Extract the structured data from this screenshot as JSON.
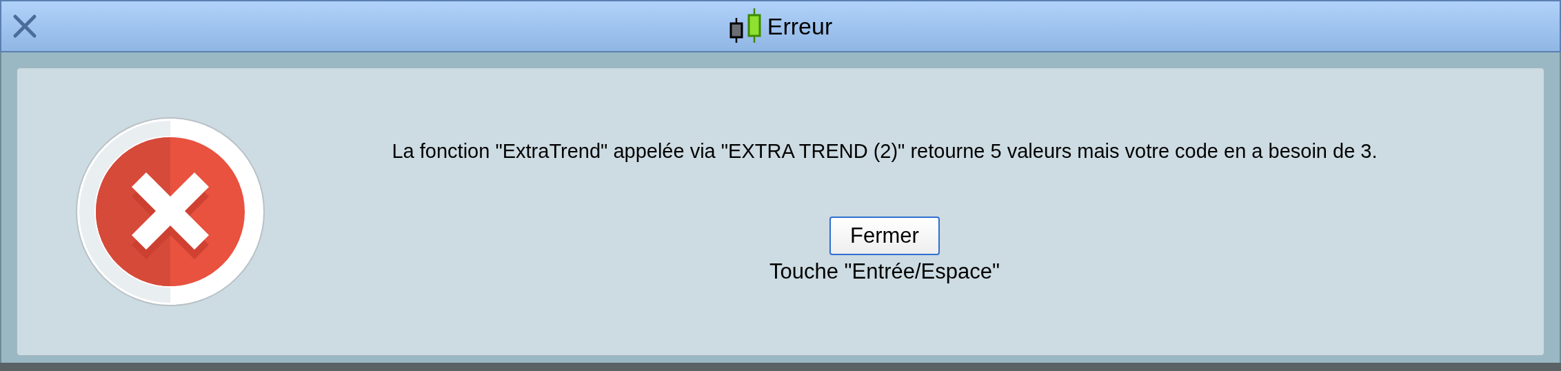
{
  "window": {
    "title": "Erreur"
  },
  "dialog": {
    "message": "La fonction \"ExtraTrend\" appelée via \"EXTRA TREND (2)\" retourne 5 valeurs mais votre code en a besoin de 3.",
    "button": "Fermer",
    "hint": "Touche \"Entrée/Espace\""
  }
}
